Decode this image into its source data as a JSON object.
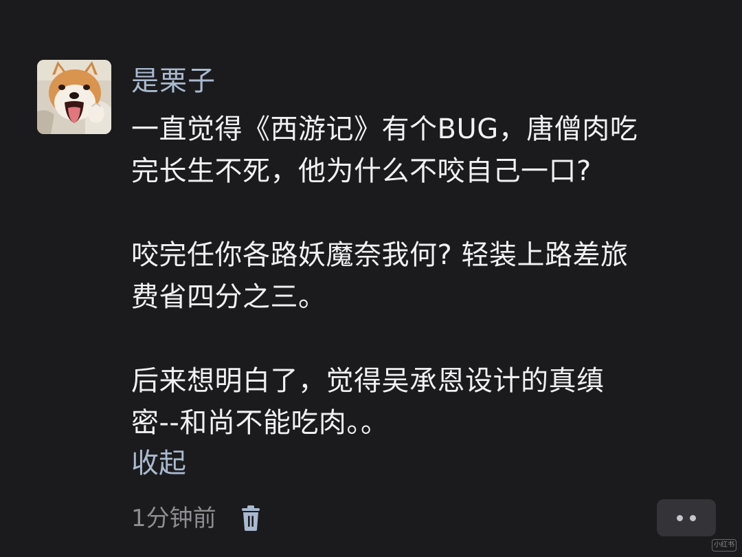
{
  "comment": {
    "author": "是栗子",
    "paragraphs": [
      "一直觉得《西游记》有个BUG，唐僧肉吃\n完长生不死，他为什么不咬自己一口?",
      "咬完任你各路妖魔奈我何? 轻装上路差旅\n费省四分之三。",
      "后来想明白了，觉得吴承恩设计的真缜\n密--和尚不能吃肉。。"
    ],
    "collapse_label": "收起",
    "timestamp": "1分钟前",
    "delete_icon": "trash-icon",
    "more_icon": "more-dots-icon"
  },
  "avatar": {
    "depicts": "shiba-inu-dog"
  },
  "watermark": {
    "text": "小红书"
  },
  "colors": {
    "background": "#1b1b1d",
    "text_primary": "#f1f1f3",
    "link": "#a9b9cf",
    "meta": "#8d8d92",
    "button_bg": "#343438"
  }
}
